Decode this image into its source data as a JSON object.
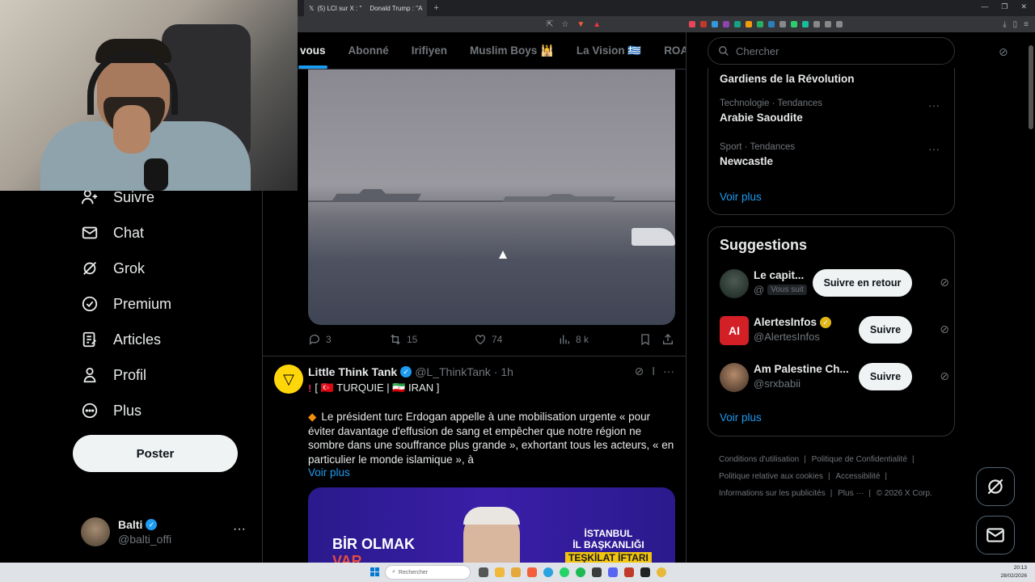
{
  "browser": {
    "tab1_title": "(5) LCI sur X : \"",
    "tab2_title": "Donald Trump : \"A"
  },
  "sidebar": {
    "items": [
      {
        "label": "Suivre"
      },
      {
        "label": "Chat"
      },
      {
        "label": "Grok"
      },
      {
        "label": "Premium"
      },
      {
        "label": "Articles"
      },
      {
        "label": "Profil"
      },
      {
        "label": "Plus"
      }
    ],
    "post_label": "Poster",
    "account": {
      "name": "Balti",
      "handle": "@balti_offi"
    }
  },
  "timeline": {
    "tabs": [
      "vous",
      "Abonné",
      "Irifiyen",
      "Muslim Boys 🕌",
      "La Vision 🇬🇷",
      "ROAD"
    ],
    "prev_tweet": {
      "replies": "3",
      "reposts": "15",
      "likes": "74",
      "views": "8 k"
    },
    "tweet": {
      "author": "Little Think Tank",
      "handle": "@L_ThinkTank",
      "time": "· 1h",
      "tag_line": "[ 🇹🇷 TURQUIE | 🇮🇷 IRAN ]",
      "body": "Le président turc Erdogan appelle à une mobilisation urgente « pour éviter davantage d'effusion de sang et empêcher que notre région ne sombre dans une souffrance plus grande », exhortant tous les acteurs, « en particulier le monde islamique », à",
      "more": "Voir plus",
      "image_text_left": "BİR OLMAK",
      "image_text_left2": "VAR",
      "image_text_right1": "İSTANBUL",
      "image_text_right2": "İL BAŞKANLIĞI",
      "image_text_right3": "TEŞKİLAT İFTARI"
    }
  },
  "right": {
    "search_placeholder": "Chercher",
    "trends": [
      {
        "category": "",
        "title": "Gardiens de la Révolution"
      },
      {
        "category": "Technologie · Tendances",
        "title": "Arabie Saoudite"
      },
      {
        "category": "Sport · Tendances",
        "title": "Newcastle"
      }
    ],
    "trends_more": "Voir plus",
    "suggestions_title": "Suggestions",
    "suggestions": [
      {
        "name": "Le capit...",
        "handle": "@",
        "badge": "Vous suit",
        "button": "Suivre en retour"
      },
      {
        "name": "AlertesInfos",
        "handle": "@AlertesInfos",
        "button": "Suivre"
      },
      {
        "name": "Am Palestine Ch...",
        "handle": "@srxbabii",
        "button": "Suivre"
      }
    ],
    "suggestions_more": "Voir plus",
    "footer": [
      "Conditions d'utilisation",
      "Politique de Confidentialité",
      "Politique relative aux cookies",
      "Accessibilité",
      "Informations sur les publicités",
      "Plus ···",
      "© 2026 X Corp."
    ]
  },
  "taskbar": {
    "search_placeholder": "Rechercher",
    "time": "20:13",
    "date": "28/02/2026"
  }
}
